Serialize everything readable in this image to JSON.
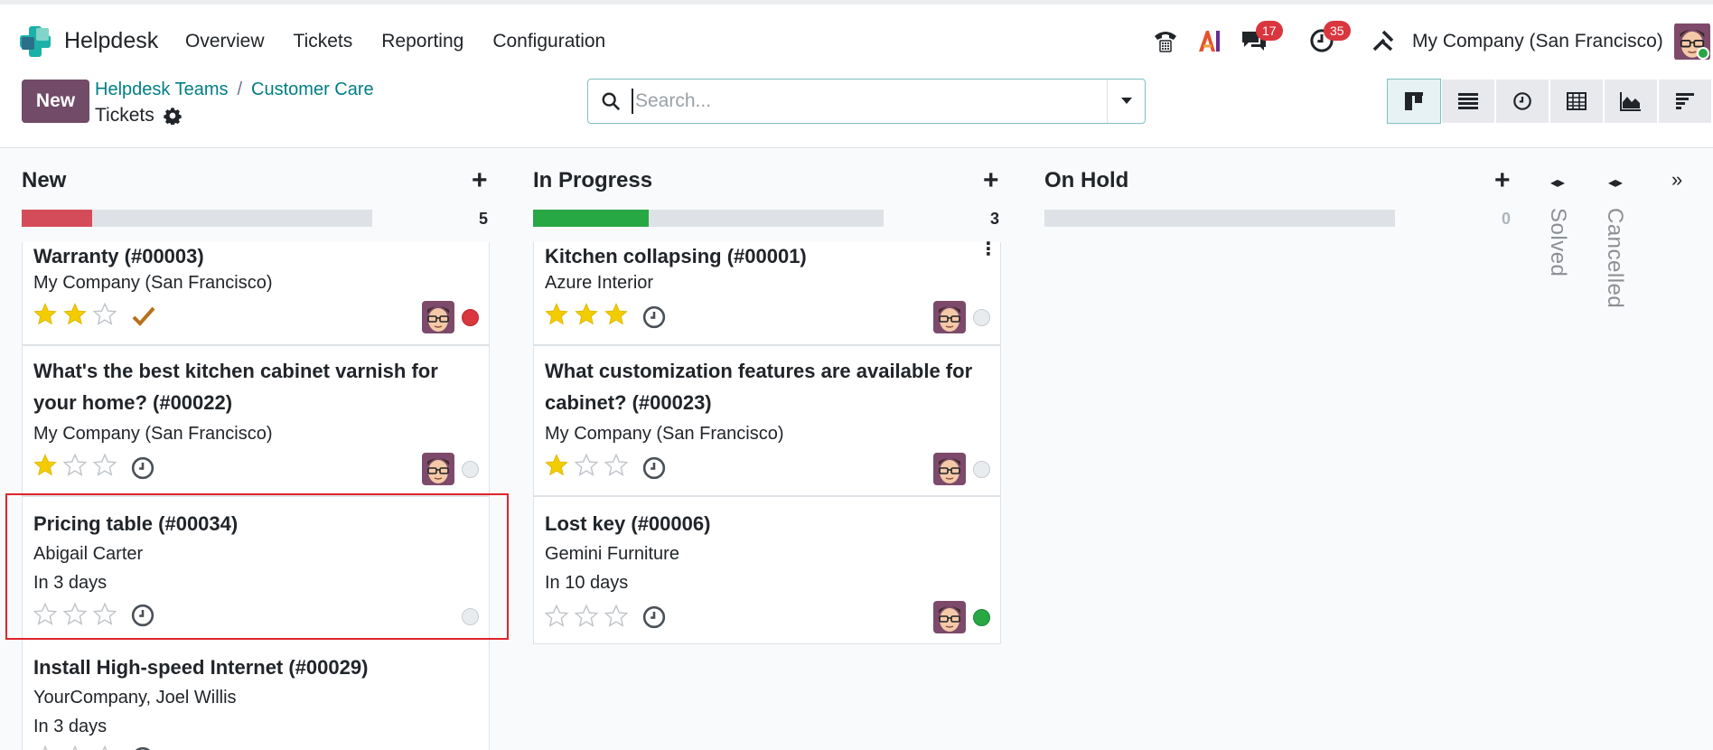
{
  "app": {
    "name": "Helpdesk"
  },
  "menu": [
    "Overview",
    "Tickets",
    "Reporting",
    "Configuration"
  ],
  "systray": {
    "discuss_badge": "17",
    "activity_badge": "35",
    "company": "My Company (San Francisco)"
  },
  "control": {
    "new_label": "New",
    "breadcrumb": [
      "Helpdesk Teams",
      "Customer Care"
    ],
    "breadcrumb_sep": "/",
    "current": "Tickets",
    "search_placeholder": "Search..."
  },
  "views": [
    "kanban",
    "list",
    "activity",
    "pivot",
    "graph",
    "gantt"
  ],
  "columns": {
    "new": {
      "title": "New",
      "count": "5",
      "progress": 0.2,
      "color": "#d44c59"
    },
    "in_progress": {
      "title": "In Progress",
      "count": "3",
      "progress": 0.33,
      "color": "#28a745"
    },
    "on_hold": {
      "title": "On Hold",
      "count": "0",
      "progress": 0
    },
    "folded": [
      "Solved",
      "Cancelled"
    ]
  },
  "cards": {
    "n1": {
      "title": "Warranty (#00003)",
      "sub": "My Company (San Francisco)",
      "stars": 2,
      "state": "red"
    },
    "n2": {
      "title_1": "What's the best kitchen cabinet varnish for",
      "title_2": "your home? (#00022)",
      "sub": "My Company (San Francisco)",
      "stars": 1,
      "state": "grey"
    },
    "n3": {
      "title": "Pricing table (#00034)",
      "sub": "Abigail Carter",
      "deadline": "In 3 days",
      "stars": 0,
      "state": "grey"
    },
    "n4": {
      "title": "Install High-speed Internet (#00029)",
      "sub": "YourCompany, Joel Willis",
      "deadline": "In 3 days",
      "stars": 0
    },
    "p1": {
      "title": "Kitchen collapsing (#00001)",
      "sub": "Azure Interior",
      "stars": 3,
      "state": "grey"
    },
    "p2": {
      "title_1": "What customization features are available for",
      "title_2": "cabinet? (#00023)",
      "sub": "My Company (San Francisco)",
      "stars": 1,
      "state": "grey"
    },
    "p3": {
      "title": "Lost key (#00006)",
      "sub": "Gemini Furniture",
      "deadline": "In 10 days",
      "stars": 0,
      "state": "green"
    }
  },
  "colors": {
    "brand": "#714b67",
    "link": "#017e84",
    "star": "#f3cc00",
    "highlight": "#e0242b"
  }
}
